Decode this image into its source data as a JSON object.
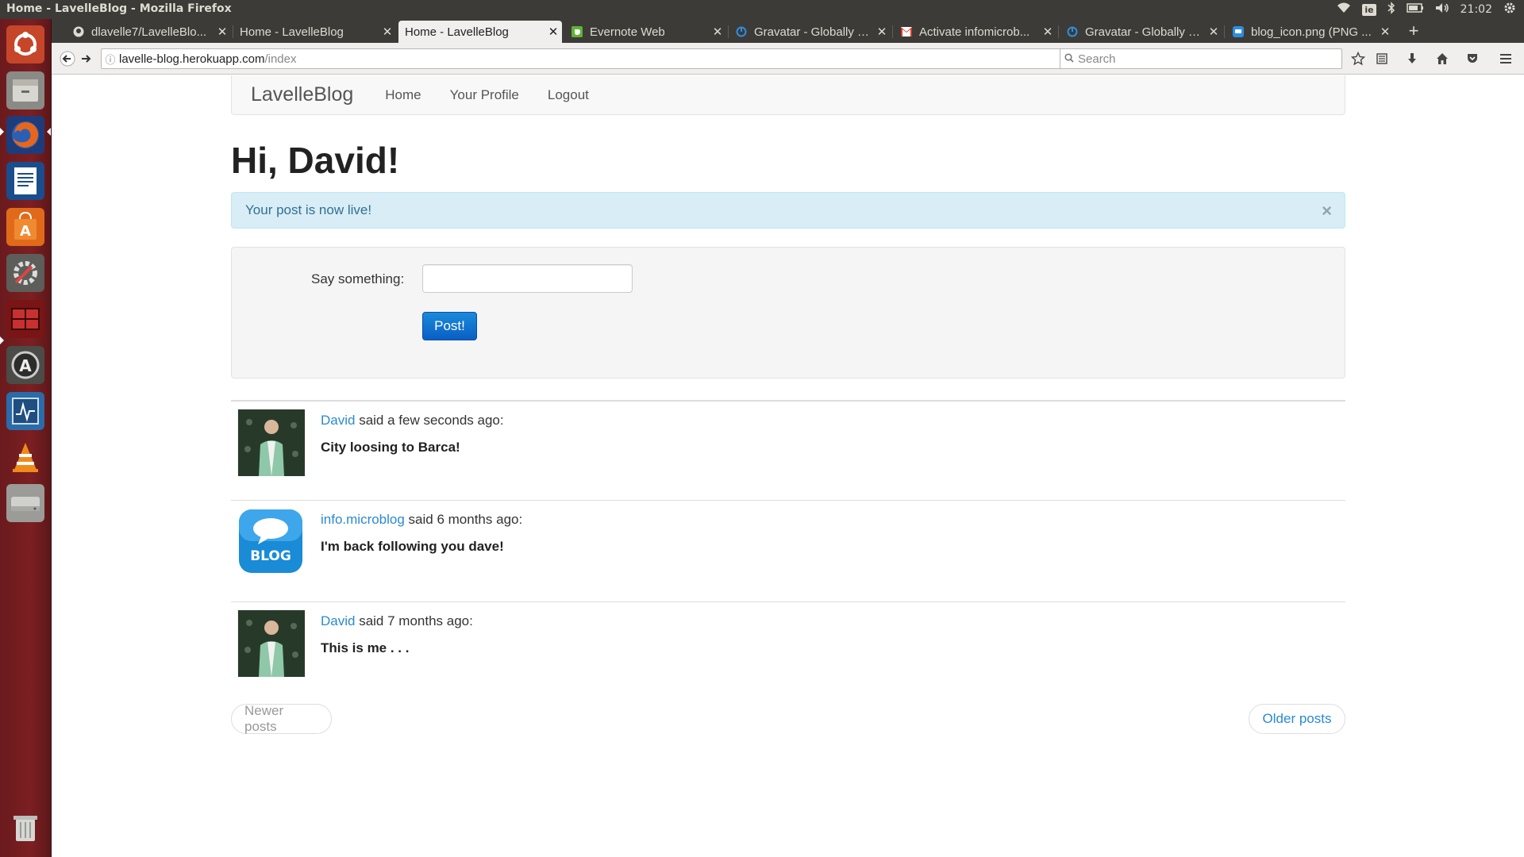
{
  "window": {
    "title": "Home - LavelleBlog - Mozilla Firefox",
    "keyboard_layout": "ie",
    "clock": "21:02"
  },
  "tabs": [
    {
      "label": "dlavelle7/LavelleBlo...",
      "favicon": "github-icon",
      "active": false
    },
    {
      "label": "Home - LavelleBlog",
      "favicon": "none",
      "active": false
    },
    {
      "label": "Home - LavelleBlog",
      "favicon": "none",
      "active": true
    },
    {
      "label": "Evernote Web",
      "favicon": "evernote-icon",
      "active": false
    },
    {
      "label": "Gravatar - Globally R...",
      "favicon": "gravatar-icon",
      "active": false
    },
    {
      "label": "Activate infomicrob...",
      "favicon": "gmail-icon",
      "active": false
    },
    {
      "label": "Gravatar - Globally R...",
      "favicon": "gravatar-icon",
      "active": false
    },
    {
      "label": "blog_icon.png (PNG ...",
      "favicon": "image-icon",
      "active": false
    }
  ],
  "toolbar": {
    "url_host": "lavelle-blog.herokuapp.com",
    "url_path": "/index",
    "search_placeholder": "Search"
  },
  "site": {
    "brand": "LavelleBlog",
    "nav": [
      "Home",
      "Your Profile",
      "Logout"
    ]
  },
  "page": {
    "greeting": "Hi, David!",
    "alert": "Your post is now live!",
    "alert_close": "×",
    "form_label": "Say something:",
    "form_value": "",
    "post_button": "Post!"
  },
  "posts": [
    {
      "author": "David",
      "meta": " said a few seconds ago:",
      "body": "City loosing to Barca!",
      "avatar": "photo"
    },
    {
      "author": "info.microblog",
      "meta": " said 6 months ago:",
      "body": "I'm back following you dave!",
      "avatar": "blog",
      "avatar_text": "BLOG"
    },
    {
      "author": "David",
      "meta": " said 7 months ago:",
      "body": "This is me . . .",
      "avatar": "photo"
    }
  ],
  "pager": {
    "newer": "Newer posts",
    "older": "Older posts"
  },
  "colors": {
    "link": "#2a8ad1",
    "alert_bg": "#d9edf7",
    "alert_text": "#31708f",
    "launcher": "#7c1f22",
    "button": "#0a5fc4"
  }
}
